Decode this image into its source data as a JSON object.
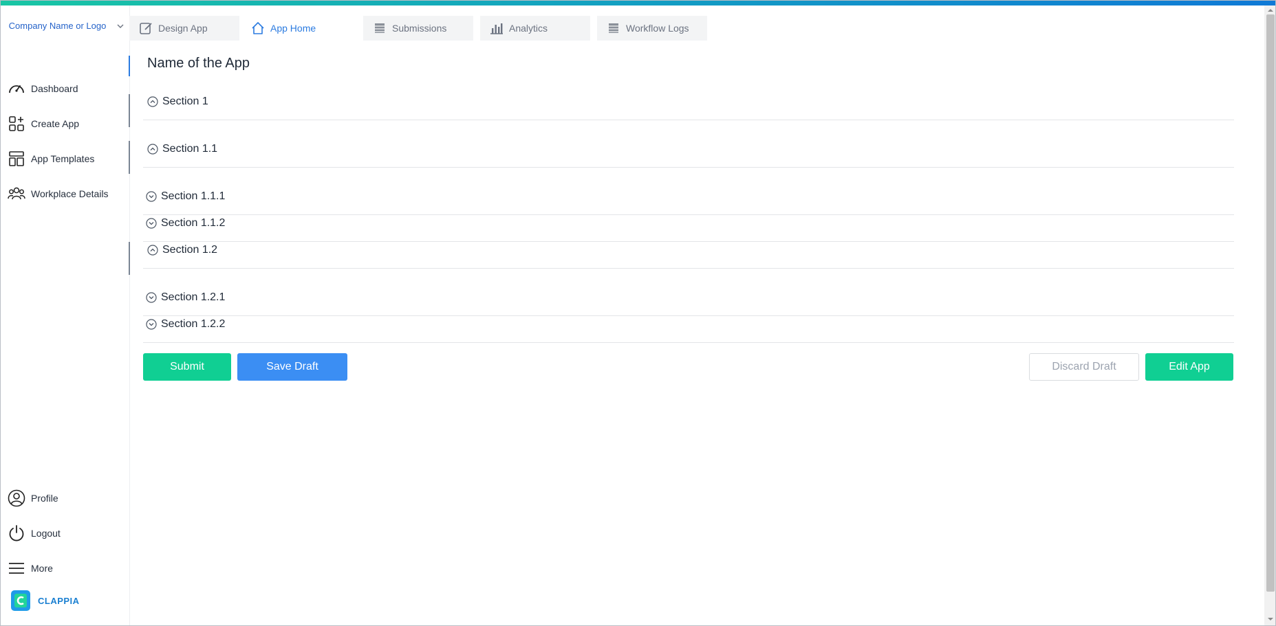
{
  "sidebar": {
    "company": "Company Name or Logo",
    "nav": [
      {
        "label": "Dashboard",
        "icon": "gauge-icon"
      },
      {
        "label": "Create App",
        "icon": "apps-plus-icon"
      },
      {
        "label": "App Templates",
        "icon": "template-icon"
      },
      {
        "label": "Workplace Details",
        "icon": "users-icon"
      }
    ],
    "bottom_nav": [
      {
        "label": "Profile",
        "icon": "user-circle-icon"
      },
      {
        "label": "Logout",
        "icon": "power-icon"
      },
      {
        "label": "More",
        "icon": "menu-icon"
      }
    ],
    "brand": "CLAPPIA"
  },
  "tabs": [
    {
      "label": "Design App",
      "icon": "edit-icon",
      "active": false
    },
    {
      "label": "App Home",
      "icon": "home-icon",
      "active": true
    },
    {
      "label": "Submissions",
      "icon": "list-icon",
      "active": false
    },
    {
      "label": "Analytics",
      "icon": "bar-chart-icon",
      "active": false
    },
    {
      "label": "Workflow Logs",
      "icon": "list-icon",
      "active": false
    }
  ],
  "app": {
    "title": "Name of the App",
    "sections": [
      {
        "label": "Section 1",
        "state": "expanded"
      },
      {
        "label": "Section 1.1",
        "state": "expanded"
      },
      {
        "label": "Section 1.1.1",
        "state": "collapsed"
      },
      {
        "label": "Section 1.1.2",
        "state": "collapsed"
      },
      {
        "label": "Section 1.2",
        "state": "expanded"
      },
      {
        "label": "Section 1.2.1",
        "state": "collapsed"
      },
      {
        "label": "Section 1.2.2",
        "state": "collapsed"
      }
    ]
  },
  "actions": {
    "submit": "Submit",
    "save_draft": "Save Draft",
    "discard_draft": "Discard Draft",
    "edit_app": "Edit App"
  },
  "colors": {
    "accent_green": "#10cf93",
    "accent_blue": "#3b8ef3",
    "link_blue": "#2b7be0"
  }
}
